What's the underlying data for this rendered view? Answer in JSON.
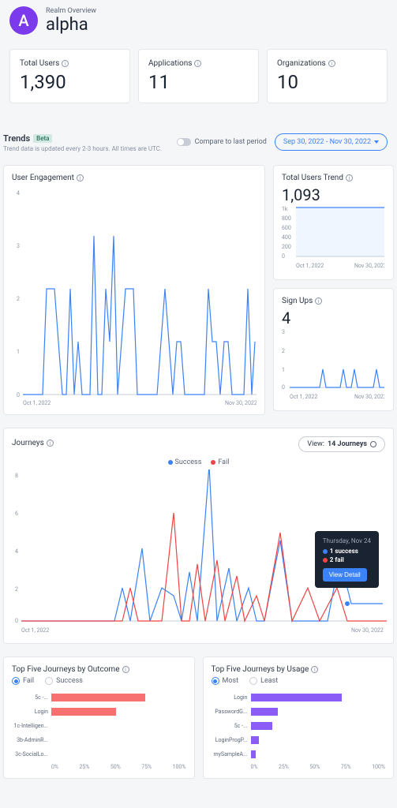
{
  "header": {
    "avatar_letter": "A",
    "subtitle": "Realm Overview",
    "title": "alpha"
  },
  "stats": {
    "users_label": "Total Users",
    "users_value": "1,390",
    "apps_label": "Applications",
    "apps_value": "11",
    "orgs_label": "Organizations",
    "orgs_value": "10"
  },
  "trends": {
    "title": "Trends",
    "badge": "Beta",
    "subtitle": "Trend data is updated every 2-3 hours. All times are UTC.",
    "compare_label": "Compare to last period",
    "date_range": "Sep 30, 2022 - Nov 30, 2022"
  },
  "engagement": {
    "title": "User Engagement",
    "x_start": "Oct 1, 2022",
    "x_end": "Nov 30, 2022"
  },
  "total_trend": {
    "title": "Total Users Trend",
    "value": "1,093",
    "x_start": "Oct 1, 2022",
    "x_end": "Nov 30, 2022"
  },
  "signups": {
    "title": "Sign Ups",
    "value": "4",
    "x_start": "Oct 1, 2022",
    "x_end": "Nov 30, 2022"
  },
  "journeys": {
    "title": "Journeys",
    "view_label": "View:",
    "view_count": "14 Journeys",
    "legend_success": "Success",
    "legend_fail": "Fail",
    "x_start": "Oct 1, 2022",
    "x_end": "Nov 30, 2022",
    "tooltip": {
      "date": "Thursday, Nov 24",
      "success": "1 success",
      "fail": "2 fail",
      "button": "View Detail"
    }
  },
  "top_outcome": {
    "title": "Top Five Journeys by Outcome",
    "radio1": "Fail",
    "radio2": "Success",
    "bars": [
      {
        "label": "5c -...",
        "value": 70
      },
      {
        "label": "Login",
        "value": 48
      },
      {
        "label": "1c-Intelligen...",
        "value": 0
      },
      {
        "label": "3b-AdminR...",
        "value": 0
      },
      {
        "label": "3c-SocialLo...",
        "value": 0
      }
    ],
    "ticks": [
      "0%",
      "25%",
      "50%",
      "75%",
      "100%"
    ]
  },
  "top_usage": {
    "title": "Top Five Journeys by Usage",
    "radio1": "Most",
    "radio2": "Least",
    "bars": [
      {
        "label": "Login",
        "value": 68
      },
      {
        "label": "PasswordG...",
        "value": 20
      },
      {
        "label": "5c -...",
        "value": 16
      },
      {
        "label": "LoginProgP...",
        "value": 6
      },
      {
        "label": "mySampleA...",
        "value": 4
      }
    ],
    "ticks": [
      "0%",
      "25%",
      "50%",
      "75%",
      "100%"
    ]
  },
  "chart_data": [
    {
      "type": "line",
      "title": "User Engagement",
      "xlabel": "",
      "ylabel": "",
      "x": [
        "Oct 1, 2022",
        "Nov 30, 2022"
      ],
      "ylim": [
        0,
        4
      ],
      "yticks": [
        0,
        1,
        2,
        3,
        4
      ],
      "series": [
        {
          "name": "Engagement",
          "values_approx": [
            0,
            0,
            0,
            0,
            0,
            0,
            2,
            2,
            2,
            1,
            0,
            0,
            2,
            0,
            1,
            0,
            0,
            3,
            0,
            0,
            2,
            1,
            3,
            0,
            1,
            2,
            2,
            2,
            0,
            0,
            0,
            0,
            0,
            0,
            1,
            2,
            1,
            0,
            1,
            1,
            0,
            0,
            0,
            0,
            0,
            0,
            2,
            1,
            1,
            0,
            1,
            1,
            0,
            0,
            0,
            0,
            0,
            2,
            0,
            1
          ]
        }
      ]
    },
    {
      "type": "area",
      "title": "Total Users Trend",
      "x": [
        "Oct 1, 2022",
        "Nov 30, 2022"
      ],
      "ylim": [
        0,
        1000
      ],
      "yticks": [
        0,
        200,
        400,
        600,
        800,
        "1k"
      ],
      "series": [
        {
          "name": "Total Users",
          "value_approx": 1093,
          "flat": true
        }
      ]
    },
    {
      "type": "line",
      "title": "Sign Ups",
      "x": [
        "Oct 1, 2022",
        "Nov 30, 2022"
      ],
      "ylim": [
        0,
        3
      ],
      "yticks": [
        0,
        1,
        2,
        3
      ],
      "series": [
        {
          "name": "Sign Ups",
          "spikes_approx": [
            {
              "pos": 0.35,
              "val": 1
            },
            {
              "pos": 0.55,
              "val": 1
            },
            {
              "pos": 0.65,
              "val": 1
            },
            {
              "pos": 0.9,
              "val": 1
            }
          ]
        }
      ]
    },
    {
      "type": "line",
      "title": "Journeys",
      "x": [
        "Oct 1, 2022",
        "Nov 30, 2022"
      ],
      "ylim": [
        0,
        8
      ],
      "yticks": [
        0,
        2,
        4,
        6,
        8
      ],
      "series": [
        {
          "name": "Success",
          "color": "#3b82f6"
        },
        {
          "name": "Fail",
          "color": "#ef4444"
        }
      ]
    },
    {
      "type": "bar",
      "title": "Top Five Journeys by Outcome (Fail)",
      "orientation": "horizontal",
      "xlim": [
        0,
        100
      ],
      "categories": [
        "5c -...",
        "Login",
        "1c-Intelligen...",
        "3b-AdminR...",
        "3c-SocialLo..."
      ],
      "values": [
        70,
        48,
        0,
        0,
        0
      ],
      "color": "#f87171"
    },
    {
      "type": "bar",
      "title": "Top Five Journeys by Usage (Most)",
      "orientation": "horizontal",
      "xlim": [
        0,
        100
      ],
      "categories": [
        "Login",
        "PasswordG...",
        "5c -...",
        "LoginProgP...",
        "mySampleA..."
      ],
      "values": [
        68,
        20,
        16,
        6,
        4
      ],
      "color": "#8b5cf6"
    }
  ]
}
